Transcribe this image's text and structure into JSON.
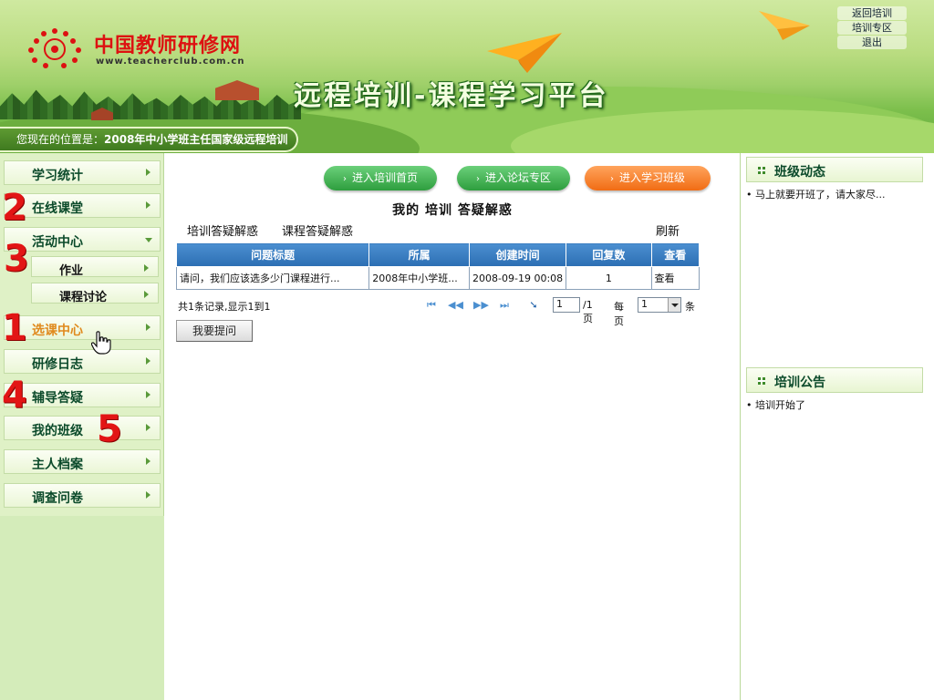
{
  "header": {
    "site_name": "中国教师研修网",
    "site_url": "www.teacherclub.com.cn",
    "platform_title": "远程培训-课程学习平台",
    "top_links": [
      "返回培训",
      "培训专区",
      "退出"
    ],
    "location_prefix": "您现在的位置是：",
    "location_value": "2008年中小学班主任国家级远程培训"
  },
  "sidebar": {
    "items": [
      {
        "label": "学习统计"
      },
      {
        "label": "在线课堂"
      },
      {
        "label": "活动中心"
      },
      {
        "label": "作业"
      },
      {
        "label": "课程讨论"
      },
      {
        "label": "选课中心"
      },
      {
        "label": "研修日志"
      },
      {
        "label": "辅导答疑"
      },
      {
        "label": "我的班级"
      },
      {
        "label": "主人档案"
      },
      {
        "label": "调查问卷"
      }
    ],
    "annotations": [
      "2",
      "3",
      "1",
      "4",
      "5"
    ]
  },
  "main": {
    "buttons": [
      "进入培训首页",
      "进入论坛专区",
      "进入学习班级"
    ],
    "title": "我的 培训 答疑解惑",
    "subtabs": [
      "培训答疑解惑",
      "课程答疑解惑"
    ],
    "refresh": "刷新",
    "table": {
      "headers": [
        "问题标题",
        "所属",
        "创建时间",
        "回复数",
        "查看"
      ],
      "rows": [
        [
          "请问，我们应该选多少门课程进行...",
          "2008年中小学班...",
          "2008-09-19 00:08",
          "1",
          "查看"
        ]
      ]
    },
    "records": "共1条记录,显示1到1",
    "pager": {
      "page_value": "1",
      "total_pages": "/1页",
      "per_page_label": "每页",
      "per_page_value": "1",
      "unit": "条"
    },
    "ask_button": "我要提问"
  },
  "right": {
    "class_news_title": "班级动态",
    "class_news": [
      "马上就要开班了，请大家尽..."
    ],
    "notice_title": "培训公告",
    "notices": [
      "培训开始了"
    ]
  },
  "colors": {
    "header_green": "#7cbf4c",
    "table_header_blue": "#2c6eb3",
    "orange_button": "#f16c14",
    "annotation_red": "#e21515"
  }
}
